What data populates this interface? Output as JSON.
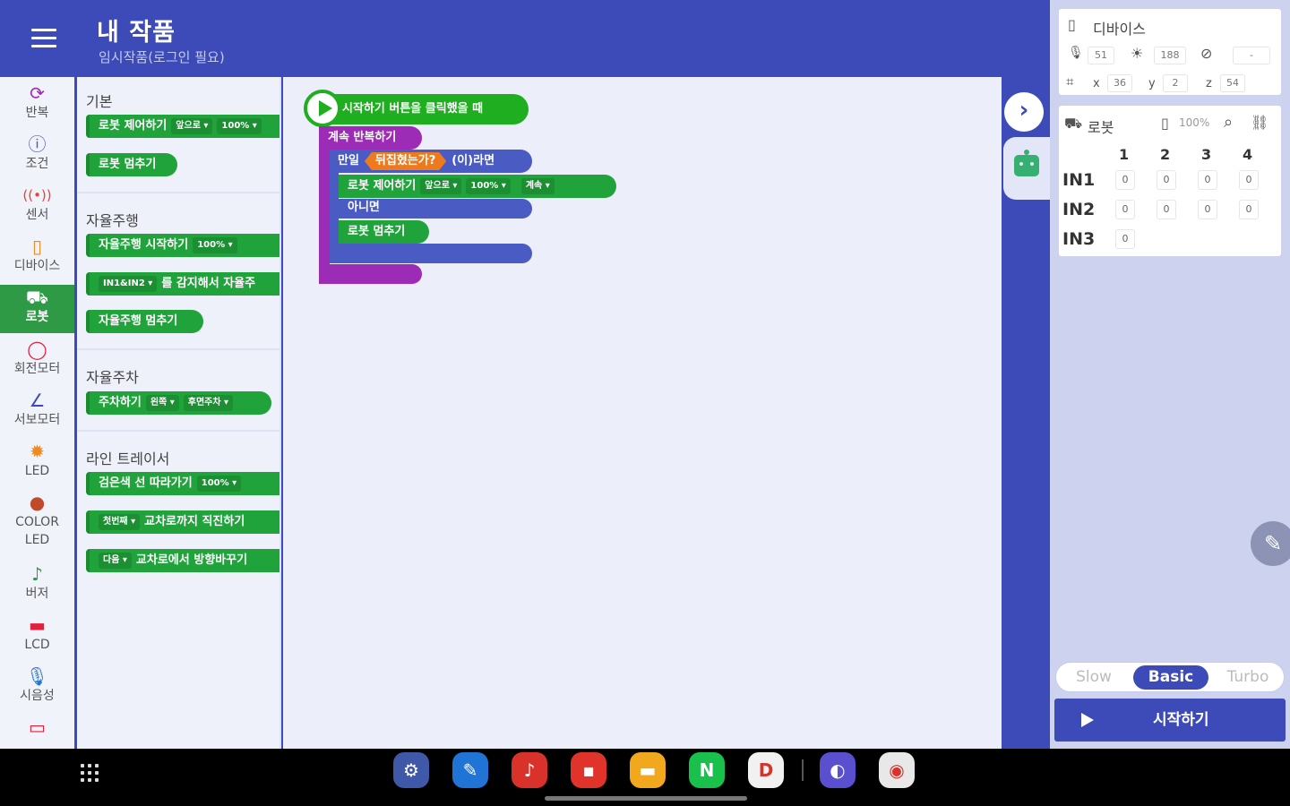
{
  "header": {
    "title": "내 작품",
    "subtitle": "임시작품(로그인 필요)"
  },
  "categories": [
    {
      "label": "반복",
      "icon": "refresh-icon",
      "active": false
    },
    {
      "label": "조건",
      "icon": "question-icon",
      "active": false
    },
    {
      "label": "센서",
      "icon": "sensor-icon",
      "active": false
    },
    {
      "label": "디바이스",
      "icon": "device-icon",
      "active": false
    },
    {
      "label": "로봇",
      "icon": "robot-car-icon",
      "active": true
    },
    {
      "label": "회전모터",
      "icon": "motor-icon",
      "active": false
    },
    {
      "label": "서보모터",
      "icon": "servo-icon",
      "active": false
    },
    {
      "label": "LED",
      "icon": "led-icon",
      "active": false
    },
    {
      "label": "COLOR LED",
      "icon": "palette-icon",
      "active": false
    },
    {
      "label": "버저",
      "icon": "music-note-icon",
      "active": false
    },
    {
      "label": "LCD",
      "icon": "lcd-icon",
      "active": false
    },
    {
      "label": "시음성",
      "icon": "mic-icon",
      "active": false
    }
  ],
  "flyout": {
    "basic": {
      "title": "기본",
      "control": {
        "label": "로봇 제어하기",
        "dir": "앞으로",
        "speed": "100%"
      },
      "stop": "로봇 멈추기"
    },
    "autonomous": {
      "title": "자율주행",
      "start": {
        "label": "자율주행 시작하기",
        "speed": "100%"
      },
      "sensor": {
        "port": "IN1&IN2",
        "label": "를 감지해서 자율주"
      },
      "stop": "자율주행 멈추기"
    },
    "parking": {
      "title": "자율주차",
      "park": {
        "label": "주차하기",
        "side": "왼쪽",
        "mode": "후면주차"
      }
    },
    "line": {
      "title": "라인 트레이서",
      "follow": {
        "label": "검은색 선 따라가기",
        "speed": "100%"
      },
      "cross": {
        "which": "첫번째",
        "label": "교차로까지 직진하기"
      },
      "turn": {
        "which": "다음",
        "label": "교차로에서 방향바꾸기"
      }
    }
  },
  "program": {
    "hat": "시작하기 버튼을 클릭했을 때",
    "loop": "계속 반복하기",
    "if_label": "만일",
    "condition": "뒤집혔는가?",
    "if_suffix": "(이)라면",
    "control": {
      "label": "로봇 제어하기",
      "dir": "앞으로",
      "speed": "100%",
      "time": "계속"
    },
    "else_label": "아니면",
    "stop": "로봇 멈추기"
  },
  "device": {
    "title": "디바이스",
    "mic": "51",
    "light": "188",
    "tilt": "-",
    "x_label": "x",
    "x": "36",
    "y_label": "y",
    "y": "2",
    "z_label": "z",
    "z": "54"
  },
  "robot": {
    "title": "로봇",
    "battery": "100%",
    "columns": [
      "1",
      "2",
      "3",
      "4"
    ],
    "rows": [
      {
        "label": "IN1",
        "values": [
          "0",
          "0",
          "0",
          "0"
        ]
      },
      {
        "label": "IN2",
        "values": [
          "0",
          "0",
          "0",
          "0"
        ]
      },
      {
        "label": "IN3",
        "values": [
          "0"
        ]
      }
    ]
  },
  "speed": {
    "options": [
      "Slow",
      "Basic",
      "Turbo"
    ],
    "selected": "Basic"
  },
  "start_button": "시작하기",
  "colors": {
    "primary": "#3c4bb8",
    "block_green": "#21a33b",
    "loop_purple": "#9c2bb5",
    "if_blue": "#4a5bc4",
    "cond_orange": "#ee7a1e"
  },
  "taskbar": {
    "apps": [
      {
        "name": "settings-app-icon",
        "glyph": "⚙",
        "color": "#3f58a8"
      },
      {
        "name": "pen-app-icon",
        "glyph": "✎",
        "color": "#1f74d6"
      },
      {
        "name": "recorder-app-icon",
        "glyph": "♪",
        "color": "#d8322b"
      },
      {
        "name": "notes-app-icon",
        "glyph": "▪",
        "color": "#e0342a"
      },
      {
        "name": "files-app-icon",
        "glyph": "▬",
        "color": "#f2a81d"
      },
      {
        "name": "naver-app-icon",
        "glyph": "N",
        "color": "#19c04b"
      },
      {
        "name": "docs-app-icon",
        "glyph": "D",
        "color": "#f1f1f1"
      },
      {
        "name": "browser-app-icon",
        "glyph": "◐",
        "color": "#5a4fcf"
      },
      {
        "name": "chrome-app-icon",
        "glyph": "◉",
        "color": "#e8e8e8"
      }
    ]
  }
}
